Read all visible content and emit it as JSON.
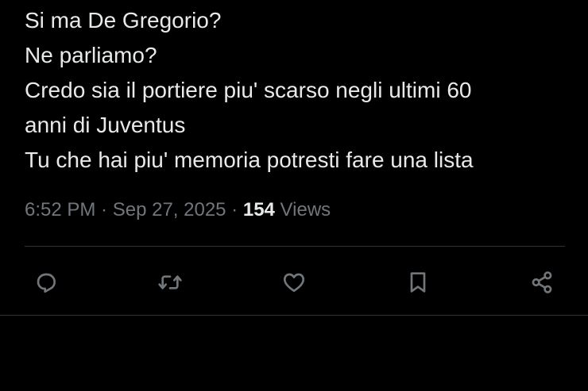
{
  "tweet": {
    "lines": [
      "Si ma De Gregorio?",
      "Ne parliamo?",
      "Credo sia il portiere piu' scarso negli ultimi 60",
      "anni di Juventus",
      "Tu che hai piu' memoria potresti fare una lista"
    ]
  },
  "meta": {
    "time": "6:52 PM",
    "separator": " · ",
    "date": "Sep 27, 2025",
    "views_count": "154",
    "views_label": " Views"
  },
  "actions": {
    "reply_icon": "reply-icon",
    "retweet_icon": "retweet-icon",
    "like_icon": "heart-icon",
    "bookmark_icon": "bookmark-icon",
    "share_icon": "share-icon"
  },
  "colors": {
    "background": "#000000",
    "text": "#e7e9ea",
    "muted": "#71767b",
    "divider": "#2f3336"
  }
}
